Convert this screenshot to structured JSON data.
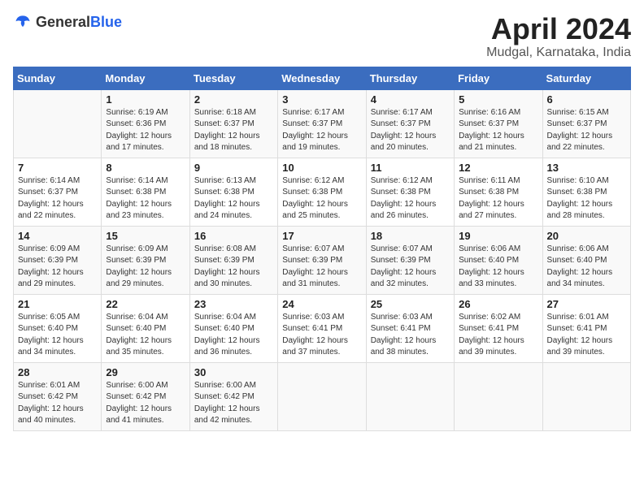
{
  "logo": {
    "general": "General",
    "blue": "Blue"
  },
  "title": "April 2024",
  "location": "Mudgal, Karnataka, India",
  "days_of_week": [
    "Sunday",
    "Monday",
    "Tuesday",
    "Wednesday",
    "Thursday",
    "Friday",
    "Saturday"
  ],
  "weeks": [
    [
      {
        "day": "",
        "sunrise": "",
        "sunset": "",
        "daylight": ""
      },
      {
        "day": "1",
        "sunrise": "Sunrise: 6:19 AM",
        "sunset": "Sunset: 6:36 PM",
        "daylight": "Daylight: 12 hours and 17 minutes."
      },
      {
        "day": "2",
        "sunrise": "Sunrise: 6:18 AM",
        "sunset": "Sunset: 6:37 PM",
        "daylight": "Daylight: 12 hours and 18 minutes."
      },
      {
        "day": "3",
        "sunrise": "Sunrise: 6:17 AM",
        "sunset": "Sunset: 6:37 PM",
        "daylight": "Daylight: 12 hours and 19 minutes."
      },
      {
        "day": "4",
        "sunrise": "Sunrise: 6:17 AM",
        "sunset": "Sunset: 6:37 PM",
        "daylight": "Daylight: 12 hours and 20 minutes."
      },
      {
        "day": "5",
        "sunrise": "Sunrise: 6:16 AM",
        "sunset": "Sunset: 6:37 PM",
        "daylight": "Daylight: 12 hours and 21 minutes."
      },
      {
        "day": "6",
        "sunrise": "Sunrise: 6:15 AM",
        "sunset": "Sunset: 6:37 PM",
        "daylight": "Daylight: 12 hours and 22 minutes."
      }
    ],
    [
      {
        "day": "7",
        "sunrise": "Sunrise: 6:14 AM",
        "sunset": "Sunset: 6:37 PM",
        "daylight": "Daylight: 12 hours and 22 minutes."
      },
      {
        "day": "8",
        "sunrise": "Sunrise: 6:14 AM",
        "sunset": "Sunset: 6:38 PM",
        "daylight": "Daylight: 12 hours and 23 minutes."
      },
      {
        "day": "9",
        "sunrise": "Sunrise: 6:13 AM",
        "sunset": "Sunset: 6:38 PM",
        "daylight": "Daylight: 12 hours and 24 minutes."
      },
      {
        "day": "10",
        "sunrise": "Sunrise: 6:12 AM",
        "sunset": "Sunset: 6:38 PM",
        "daylight": "Daylight: 12 hours and 25 minutes."
      },
      {
        "day": "11",
        "sunrise": "Sunrise: 6:12 AM",
        "sunset": "Sunset: 6:38 PM",
        "daylight": "Daylight: 12 hours and 26 minutes."
      },
      {
        "day": "12",
        "sunrise": "Sunrise: 6:11 AM",
        "sunset": "Sunset: 6:38 PM",
        "daylight": "Daylight: 12 hours and 27 minutes."
      },
      {
        "day": "13",
        "sunrise": "Sunrise: 6:10 AM",
        "sunset": "Sunset: 6:38 PM",
        "daylight": "Daylight: 12 hours and 28 minutes."
      }
    ],
    [
      {
        "day": "14",
        "sunrise": "Sunrise: 6:09 AM",
        "sunset": "Sunset: 6:39 PM",
        "daylight": "Daylight: 12 hours and 29 minutes."
      },
      {
        "day": "15",
        "sunrise": "Sunrise: 6:09 AM",
        "sunset": "Sunset: 6:39 PM",
        "daylight": "Daylight: 12 hours and 29 minutes."
      },
      {
        "day": "16",
        "sunrise": "Sunrise: 6:08 AM",
        "sunset": "Sunset: 6:39 PM",
        "daylight": "Daylight: 12 hours and 30 minutes."
      },
      {
        "day": "17",
        "sunrise": "Sunrise: 6:07 AM",
        "sunset": "Sunset: 6:39 PM",
        "daylight": "Daylight: 12 hours and 31 minutes."
      },
      {
        "day": "18",
        "sunrise": "Sunrise: 6:07 AM",
        "sunset": "Sunset: 6:39 PM",
        "daylight": "Daylight: 12 hours and 32 minutes."
      },
      {
        "day": "19",
        "sunrise": "Sunrise: 6:06 AM",
        "sunset": "Sunset: 6:40 PM",
        "daylight": "Daylight: 12 hours and 33 minutes."
      },
      {
        "day": "20",
        "sunrise": "Sunrise: 6:06 AM",
        "sunset": "Sunset: 6:40 PM",
        "daylight": "Daylight: 12 hours and 34 minutes."
      }
    ],
    [
      {
        "day": "21",
        "sunrise": "Sunrise: 6:05 AM",
        "sunset": "Sunset: 6:40 PM",
        "daylight": "Daylight: 12 hours and 34 minutes."
      },
      {
        "day": "22",
        "sunrise": "Sunrise: 6:04 AM",
        "sunset": "Sunset: 6:40 PM",
        "daylight": "Daylight: 12 hours and 35 minutes."
      },
      {
        "day": "23",
        "sunrise": "Sunrise: 6:04 AM",
        "sunset": "Sunset: 6:40 PM",
        "daylight": "Daylight: 12 hours and 36 minutes."
      },
      {
        "day": "24",
        "sunrise": "Sunrise: 6:03 AM",
        "sunset": "Sunset: 6:41 PM",
        "daylight": "Daylight: 12 hours and 37 minutes."
      },
      {
        "day": "25",
        "sunrise": "Sunrise: 6:03 AM",
        "sunset": "Sunset: 6:41 PM",
        "daylight": "Daylight: 12 hours and 38 minutes."
      },
      {
        "day": "26",
        "sunrise": "Sunrise: 6:02 AM",
        "sunset": "Sunset: 6:41 PM",
        "daylight": "Daylight: 12 hours and 39 minutes."
      },
      {
        "day": "27",
        "sunrise": "Sunrise: 6:01 AM",
        "sunset": "Sunset: 6:41 PM",
        "daylight": "Daylight: 12 hours and 39 minutes."
      }
    ],
    [
      {
        "day": "28",
        "sunrise": "Sunrise: 6:01 AM",
        "sunset": "Sunset: 6:42 PM",
        "daylight": "Daylight: 12 hours and 40 minutes."
      },
      {
        "day": "29",
        "sunrise": "Sunrise: 6:00 AM",
        "sunset": "Sunset: 6:42 PM",
        "daylight": "Daylight: 12 hours and 41 minutes."
      },
      {
        "day": "30",
        "sunrise": "Sunrise: 6:00 AM",
        "sunset": "Sunset: 6:42 PM",
        "daylight": "Daylight: 12 hours and 42 minutes."
      },
      {
        "day": "",
        "sunrise": "",
        "sunset": "",
        "daylight": ""
      },
      {
        "day": "",
        "sunrise": "",
        "sunset": "",
        "daylight": ""
      },
      {
        "day": "",
        "sunrise": "",
        "sunset": "",
        "daylight": ""
      },
      {
        "day": "",
        "sunrise": "",
        "sunset": "",
        "daylight": ""
      }
    ]
  ]
}
